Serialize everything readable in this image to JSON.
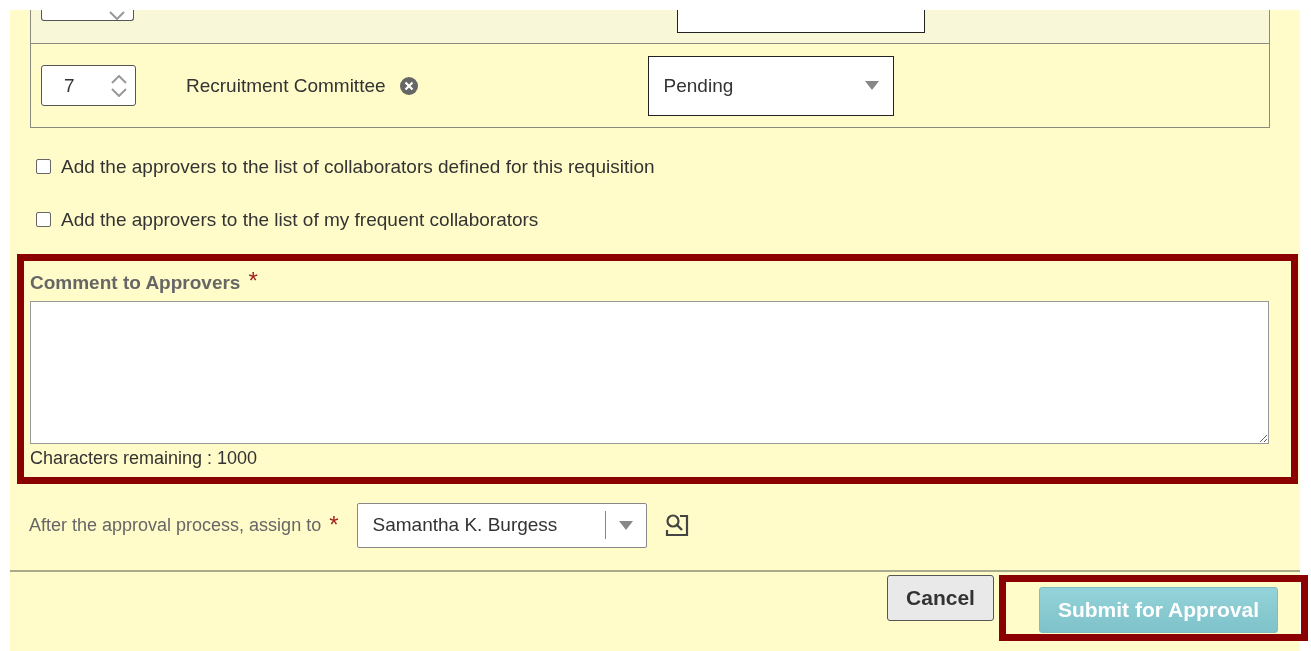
{
  "approvers": [
    {
      "order": "7",
      "name": "Recruitment Committee",
      "status": "Pending"
    }
  ],
  "options": [
    {
      "label": "Add the approvers to the list of collaborators defined for this requisition",
      "checked": false
    },
    {
      "label": "Add the approvers to the list of my frequent collaborators",
      "checked": false
    }
  ],
  "comment": {
    "label": "Comment to Approvers",
    "required_mark": "*",
    "highlighted": true,
    "counter": "Characters remaining : 1000"
  },
  "assign": {
    "label": "After the approval process, assign to",
    "required_mark": "*",
    "value": "Samantha K. Burgess"
  },
  "buttons": [
    {
      "label": "Cancel",
      "kind": "secondary"
    },
    {
      "label": "Submit for Approval",
      "kind": "primary",
      "highlighted": true
    }
  ]
}
